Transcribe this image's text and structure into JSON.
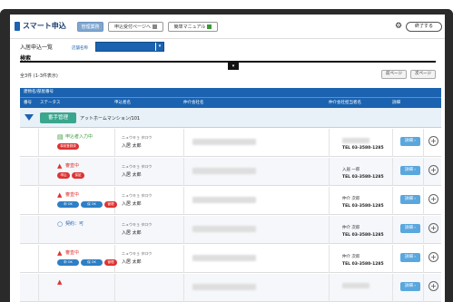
{
  "header": {
    "app_name": "スマート申込",
    "tabs": [
      {
        "label": "管理業務",
        "active": true
      },
      {
        "label": "申込受付ページへ",
        "active": false
      },
      {
        "label": "簡単マニュアル",
        "active": false
      }
    ],
    "logout_label": "終了する"
  },
  "filter": {
    "page_title": "入居申込一覧",
    "store_label": "店舗名称",
    "store_value": "",
    "search_label": "検索"
  },
  "list": {
    "count_text": "全3件 (1-3件表示)",
    "prev_label": "前ページ",
    "next_label": "次ページ",
    "group_header": "建物名/部屋番号",
    "columns": [
      "番号",
      "ステータス",
      "申込者名",
      "仲介会社名",
      "仲介会社担当者名",
      "詳細"
    ],
    "group": {
      "button": "番手管理",
      "name": "アットホームマンション/101"
    }
  },
  "rows": [
    {
      "status_icon": "doc-icon",
      "status": "申込者入力中",
      "status_color": "#3a9a3a",
      "badges": [
        {
          "text": "事前登録済",
          "color": "#d33"
        }
      ],
      "kana": "ニュウキョ タロウ",
      "name": "入居 太郎",
      "contact": "",
      "tel": "TEL 03-3580-1285"
    },
    {
      "status_icon": "warning-icon",
      "status": "審査中",
      "status_color": "#d33",
      "badges": [
        {
          "text": "申込",
          "color": "#d33"
        },
        {
          "text": "保証",
          "color": "#d33"
        }
      ],
      "kana": "ニュウキョ タロウ",
      "name": "入居 太郎",
      "contact": "入居 一郎",
      "tel": "TEL 03-3580-1285"
    },
    {
      "status_icon": "warning-icon",
      "status": "審査中",
      "status_color": "#d33",
      "badges": [
        {
          "text": "申 OK",
          "color": "#2d7fc6"
        },
        {
          "text": "保 OK",
          "color": "#2d7fc6"
        },
        {
          "text": "管理",
          "color": "#d33"
        }
      ],
      "kana": "ニュウキョ タロウ",
      "name": "入居 太郎",
      "contact": "仲介 次郎",
      "tel": "TEL 03-3580-1285"
    },
    {
      "status_icon": "circle-icon",
      "status": "契約：可",
      "status_color": "#1b63b0",
      "badges": [],
      "kana": "ニュウキョ タロウ",
      "name": "入居 太郎",
      "contact": "仲介 次郎",
      "tel": "TEL 03-3580-1285"
    },
    {
      "status_icon": "warning-icon",
      "status": "審査中",
      "status_color": "#d33",
      "badges": [
        {
          "text": "申 OK",
          "color": "#2d7fc6"
        },
        {
          "text": "保 OK",
          "color": "#2d7fc6"
        },
        {
          "text": "管理",
          "color": "#d33"
        }
      ],
      "kana": "ニュウキョ タロウ",
      "name": "入居 太郎",
      "contact": "仲介 次郎",
      "tel": "TEL 03-3580-1285"
    },
    {
      "status_icon": "warning-icon",
      "status": "",
      "status_color": "#d33",
      "badges": [],
      "kana": "",
      "name": "",
      "contact": "",
      "tel": ""
    }
  ],
  "detail_label": "詳細 ›",
  "plus_label": "+"
}
